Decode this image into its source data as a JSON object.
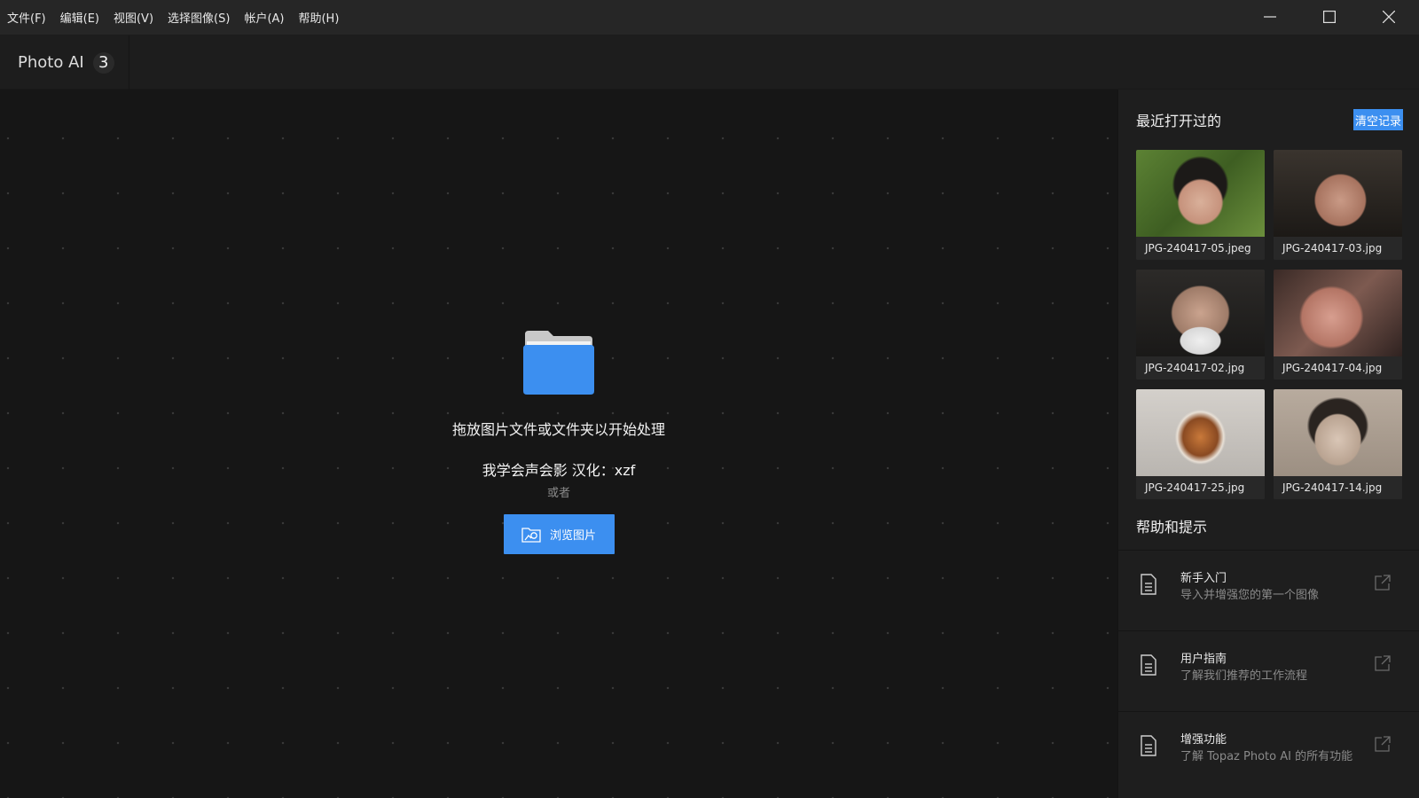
{
  "menu": [
    "文件(F)",
    "编辑(E)",
    "视图(V)",
    "选择图像(S)",
    "帐户(A)",
    "帮助(H)"
  ],
  "app": {
    "name": "Photo AI",
    "version": "3"
  },
  "drop": {
    "title": "拖放图片文件或文件夹以开始处理",
    "credit": "我学会声会影  汉化：xzf",
    "or": "或者",
    "browse": "浏览图片"
  },
  "recent": {
    "title": "最近打开过的",
    "clear": "清空记录",
    "files": [
      {
        "name": "JPG-240417-05.jpeg",
        "thumb": "portrait-young-woman-outdoor",
        "color": "#4a6b2f"
      },
      {
        "name": "JPG-240417-03.jpg",
        "thumb": "portrait-man-glasses",
        "color": "#2b2622"
      },
      {
        "name": "JPG-240417-02.jpg",
        "thumb": "portrait-old-man-beard",
        "color": "#3a3836"
      },
      {
        "name": "JPG-240417-04.jpg",
        "thumb": "portrait-woman-blurry",
        "color": "#6e4a43"
      },
      {
        "name": "JPG-240417-25.jpg",
        "thumb": "tiger-in-snow",
        "color": "#b7b3ae"
      },
      {
        "name": "JPG-240417-14.jpg",
        "thumb": "portrait-girl",
        "color": "#a79a8c"
      }
    ]
  },
  "help": {
    "title": "帮助和提示",
    "items": [
      {
        "name": "新手入门",
        "desc": "导入并增强您的第一个图像"
      },
      {
        "name": "用户指南",
        "desc": "了解我们推荐的工作流程"
      },
      {
        "name": "增强功能",
        "desc": "了解 Topaz Photo AI 的所有功能"
      }
    ]
  },
  "colors": {
    "accent": "#3c8ff0",
    "background": "#161616",
    "panel": "#1e1e1e"
  }
}
